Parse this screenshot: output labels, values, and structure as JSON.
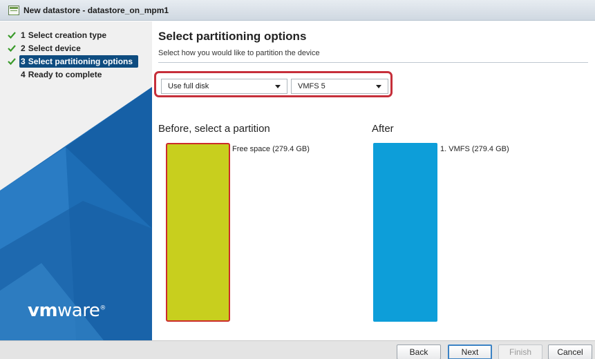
{
  "window": {
    "title": "New datastore - datastore_on_mpm1"
  },
  "sidebar": {
    "steps": [
      {
        "number": "1",
        "label": "Select creation type",
        "state": "complete"
      },
      {
        "number": "2",
        "label": "Select device",
        "state": "complete"
      },
      {
        "number": "3",
        "label": "Select partitioning options",
        "state": "current"
      },
      {
        "number": "4",
        "label": "Ready to complete",
        "state": "pending"
      }
    ],
    "logo": {
      "vm": "vm",
      "ware": "ware"
    }
  },
  "main": {
    "title": "Select partitioning options",
    "subtitle": "Select how you would like to partition the device",
    "partition_scheme": {
      "selected": "Use full disk"
    },
    "filesystem_version": {
      "selected": "VMFS 5"
    },
    "before": {
      "heading": "Before, select a partition",
      "partition_label": "Free space  (279.4 GB)"
    },
    "after": {
      "heading": "After",
      "partition_label": "1. VMFS  (279.4 GB)"
    }
  },
  "footer": {
    "back_label": "Back",
    "next_label": "Next",
    "finish_label": "Finish",
    "cancel_label": "Cancel"
  },
  "colors": {
    "free_space": "#c8cf1e",
    "vmfs": "#0d9ed9",
    "highlight_border": "#c62f3a",
    "current_step": "#0e4c80"
  }
}
